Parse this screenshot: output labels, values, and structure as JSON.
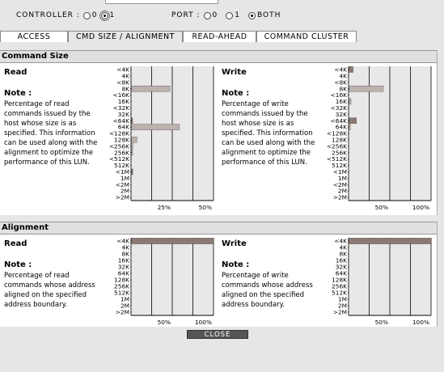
{
  "top": {
    "controller_label": "CONTROLLER :",
    "controller_opt0": "0",
    "controller_opt1": "1",
    "port_label": "PORT :",
    "port_opt0": "0",
    "port_opt1": "1",
    "port_both": "BOTH",
    "controller_selected": "1",
    "port_selected": "BOTH"
  },
  "tabs": [
    {
      "label": "ACCESS"
    },
    {
      "label": "CMD SIZE / ALIGNMENT"
    },
    {
      "label": "READ-AHEAD"
    },
    {
      "label": "COMMAND CLUSTER"
    }
  ],
  "command_size": {
    "title": "Command Size",
    "read": {
      "label": "Read",
      "note_title": "Note :",
      "note": "Percentage of read commands issued by the host whose size is as specified. This information can be used along with the alignment to optimize the performance of this LUN."
    },
    "write": {
      "label": "Write",
      "note_title": "Note :",
      "note": "Percentage of write commands issued by the host whose size is as specified. This information can be used along with the alignment to optimize the performance of this LUN."
    }
  },
  "alignment": {
    "title": "Alignment",
    "read": {
      "label": "Read",
      "note_title": "Note :",
      "note": "Percentage of read commands whose address aligned on the specified address boundary."
    },
    "write": {
      "label": "Write",
      "note_title": "Note :",
      "note": "Percentage of write commands whose address aligned on the specified address boundary."
    }
  },
  "close_label": "CLOSE",
  "chart_data": [
    {
      "type": "bar",
      "orientation": "horizontal",
      "id": "cmdsize-read",
      "categories": [
        "<4K",
        "4K",
        "<8K",
        "8K",
        "<16K",
        "16K",
        "<32K",
        "32K",
        "<64K",
        "64K",
        "<128K",
        "128K",
        "<256K",
        "256K",
        "<512K",
        "512K",
        "<1M",
        "1M",
        "<2M",
        "2M",
        ">2M"
      ],
      "values": [
        0,
        0,
        0,
        28,
        0,
        0,
        0,
        0,
        0.5,
        35,
        0,
        4,
        1,
        0.5,
        0,
        0,
        1,
        0,
        0,
        0,
        0
      ],
      "highlight": [
        false,
        false,
        false,
        false,
        false,
        false,
        false,
        false,
        true,
        false,
        false,
        false,
        false,
        false,
        false,
        false,
        true,
        false,
        false,
        false,
        false
      ],
      "ticks": [
        "25%",
        "50%"
      ],
      "xlim": [
        0,
        60
      ]
    },
    {
      "type": "bar",
      "orientation": "horizontal",
      "id": "cmdsize-write",
      "categories": [
        "<4K",
        "4K",
        "<8K",
        "8K",
        "<16K",
        "16K",
        "<32K",
        "32K",
        "<64K",
        "64K",
        "<128K",
        "128K",
        "<256K",
        "256K",
        "<512K",
        "512K",
        "<1M",
        "1M",
        "<2M",
        "2M",
        ">2M"
      ],
      "values": [
        6,
        0,
        0,
        50,
        0,
        3,
        0,
        0,
        11,
        2,
        0,
        0,
        0,
        0,
        0,
        0,
        0,
        0,
        0,
        0,
        0
      ],
      "highlight": [
        true,
        false,
        false,
        false,
        false,
        false,
        false,
        false,
        true,
        false,
        false,
        false,
        false,
        false,
        false,
        false,
        false,
        false,
        false,
        false,
        false
      ],
      "ticks": [
        "50%",
        "100%"
      ],
      "xlim": [
        0,
        120
      ]
    },
    {
      "type": "bar",
      "orientation": "horizontal",
      "id": "align-read",
      "categories": [
        "<4K",
        "4K",
        "8K",
        "16K",
        "32K",
        "64K",
        "128K",
        "256K",
        "512K",
        "1M",
        "2M",
        ">2M"
      ],
      "values": [
        100,
        0,
        0,
        0,
        0,
        0,
        0,
        0,
        0,
        0,
        0,
        0
      ],
      "highlight": [
        true,
        false,
        false,
        false,
        false,
        false,
        false,
        false,
        false,
        false,
        false,
        false
      ],
      "ticks": [
        "50%",
        "100%"
      ],
      "xlim": [
        0,
        100
      ]
    },
    {
      "type": "bar",
      "orientation": "horizontal",
      "id": "align-write",
      "categories": [
        "<4K",
        "4K",
        "8K",
        "16K",
        "32K",
        "64K",
        "128K",
        "256K",
        "512K",
        "1M",
        "2M",
        ">2M"
      ],
      "values": [
        100,
        0,
        0,
        0,
        0,
        0,
        0,
        0,
        0,
        0,
        0,
        0
      ],
      "highlight": [
        true,
        false,
        false,
        false,
        false,
        false,
        false,
        false,
        false,
        false,
        false,
        false
      ],
      "ticks": [
        "50%",
        "100%"
      ],
      "xlim": [
        0,
        100
      ]
    }
  ],
  "colors": {
    "bar": "#bcb1ad",
    "bar_highlight": "#8b7a72",
    "grid": "#000000",
    "chart_bg": "#e8e8e8",
    "close_bg": "#555555"
  }
}
